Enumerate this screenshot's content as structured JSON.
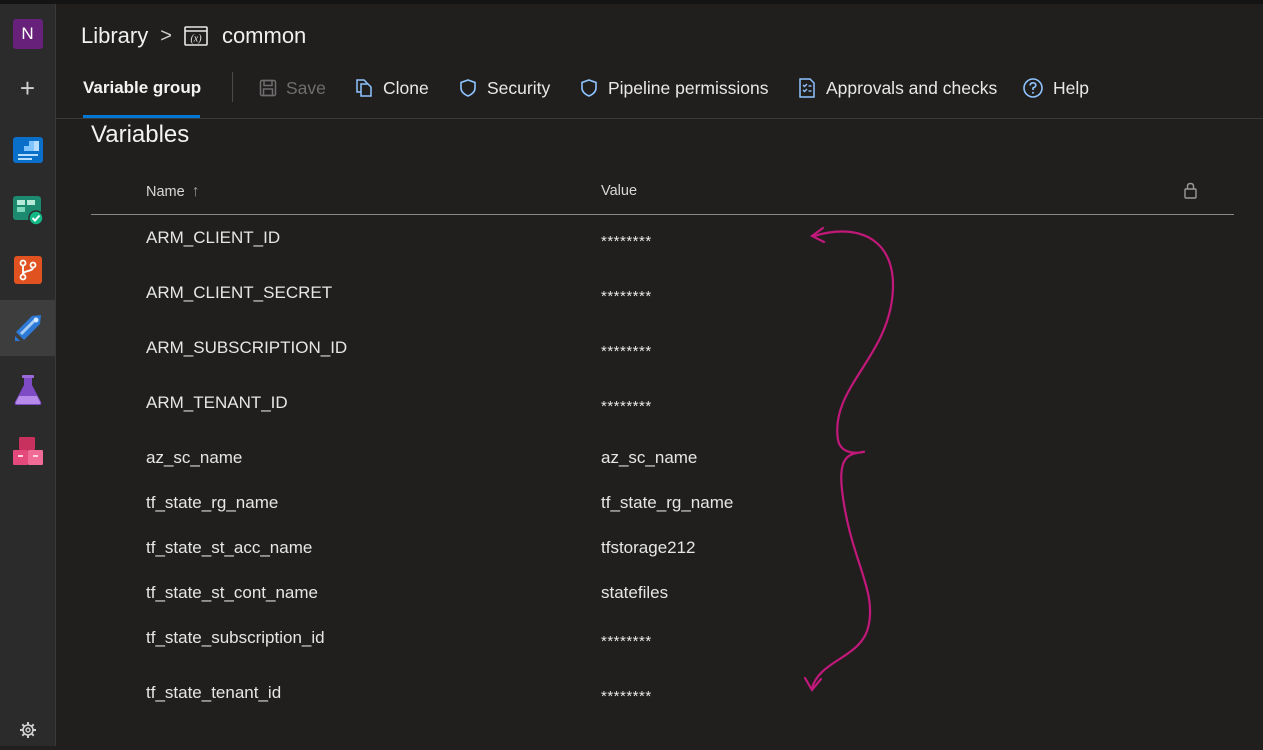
{
  "rail": {
    "org_initial": "N",
    "items": [
      {
        "name": "overview"
      },
      {
        "name": "boards"
      },
      {
        "name": "repos"
      },
      {
        "name": "pipelines"
      },
      {
        "name": "test-plans"
      },
      {
        "name": "artifacts"
      }
    ]
  },
  "breadcrumb": {
    "root": "Library",
    "separator": ">",
    "icon": "variable-group-icon",
    "current": "common"
  },
  "toolbar": {
    "active_tab": "Variable group",
    "save": "Save",
    "clone": "Clone",
    "security": "Security",
    "pipeline_permissions": "Pipeline permissions",
    "approvals": "Approvals and checks",
    "help": "Help"
  },
  "variables": {
    "title": "Variables",
    "name_header": "Name",
    "sort_indicator": "↑",
    "value_header": "Value",
    "rows": [
      {
        "name": "ARM_CLIENT_ID",
        "value": "********",
        "secret": true
      },
      {
        "name": "ARM_CLIENT_SECRET",
        "value": "********",
        "secret": true
      },
      {
        "name": "ARM_SUBSCRIPTION_ID",
        "value": "********",
        "secret": true
      },
      {
        "name": "ARM_TENANT_ID",
        "value": "********",
        "secret": true
      },
      {
        "name": "az_sc_name",
        "value": "az_sc_name",
        "secret": false
      },
      {
        "name": "tf_state_rg_name",
        "value": "tf_state_rg_name",
        "secret": false
      },
      {
        "name": "tf_state_st_acc_name",
        "value": "tfstorage212",
        "secret": false
      },
      {
        "name": "tf_state_st_cont_name",
        "value": "statefiles",
        "secret": false
      },
      {
        "name": "tf_state_subscription_id",
        "value": "********",
        "secret": true
      },
      {
        "name": "tf_state_tenant_id",
        "value": "********",
        "secret": true
      }
    ]
  },
  "colors": {
    "accent": "#0078d4",
    "annotation": "#c2187a",
    "background": "#201f1e"
  }
}
